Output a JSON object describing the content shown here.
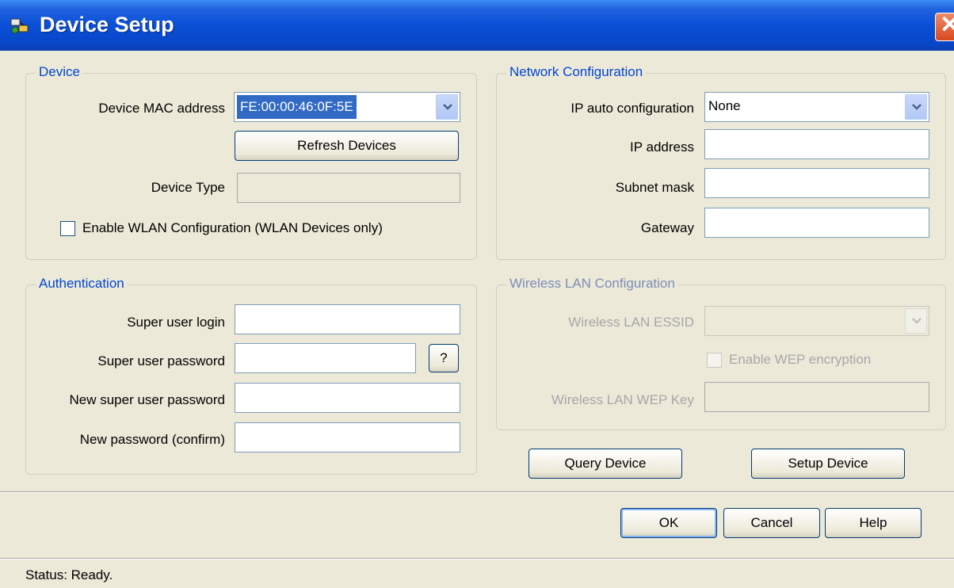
{
  "window": {
    "title": "Device Setup",
    "close_glyph": "✕"
  },
  "device": {
    "legend": "Device",
    "mac_label": "Device MAC address",
    "mac_value": "FE:00:00:46:0F:5E",
    "refresh_label": "Refresh Devices",
    "type_label": "Device Type",
    "type_value": "",
    "wlan_enable_label": "Enable WLAN Configuration (WLAN Devices only)"
  },
  "network": {
    "legend": "Network Configuration",
    "auto_label": "IP auto configuration",
    "auto_value": "None",
    "ip_label": "IP address",
    "ip_value": "",
    "subnet_label": "Subnet mask",
    "subnet_value": "",
    "gateway_label": "Gateway",
    "gateway_value": ""
  },
  "auth": {
    "legend": "Authentication",
    "login_label": "Super user login",
    "password_label": "Super user password",
    "help_label": "?",
    "new_password_label": "New super user password",
    "confirm_label": "New password (confirm)"
  },
  "wireless": {
    "legend": "Wireless LAN Configuration",
    "essid_label": "Wireless LAN ESSID",
    "essid_value": "",
    "wep_enable_label": "Enable WEP encryption",
    "wep_key_label": "Wireless LAN WEP Key"
  },
  "actions": {
    "query_label": "Query Device",
    "setup_label": "Setup Device",
    "ok_label": "OK",
    "cancel_label": "Cancel",
    "help_label": "Help"
  },
  "status": {
    "text": "Status: Ready."
  },
  "colors": {
    "titlebar": "#0a4fd6",
    "legend": "#0046d5",
    "selection": "#316ac5",
    "face": "#ece9d8"
  }
}
